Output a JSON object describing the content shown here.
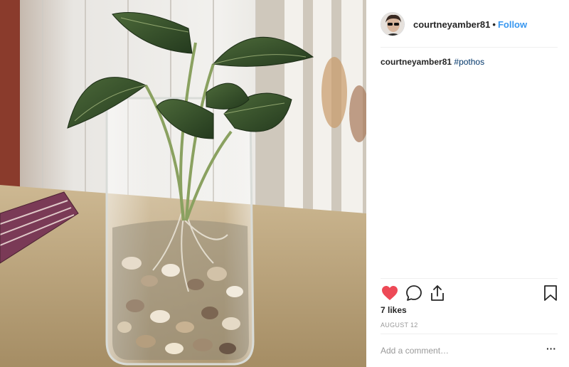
{
  "post": {
    "username": "courtneyamber81",
    "separator": "•",
    "follow_label": "Follow",
    "caption_user": "courtneyamber81",
    "caption_tag": "#pothos",
    "likes_text": "7 likes",
    "date_text": "AUGUST 12",
    "comment_placeholder": "Add a comment…",
    "more_label": "···"
  },
  "icons": {
    "avatar": "user-avatar",
    "like": "heart-icon",
    "comment": "comment-icon",
    "share": "share-icon",
    "save": "bookmark-icon",
    "more": "more-options-icon"
  },
  "colors": {
    "like_red": "#ed4956",
    "follow_blue": "#3897f0",
    "hashtag_blue": "#003569",
    "muted_text": "#999999",
    "divider": "#efefef"
  },
  "photo": {
    "subject": "pothos cutting in glass vase with pebbles"
  }
}
